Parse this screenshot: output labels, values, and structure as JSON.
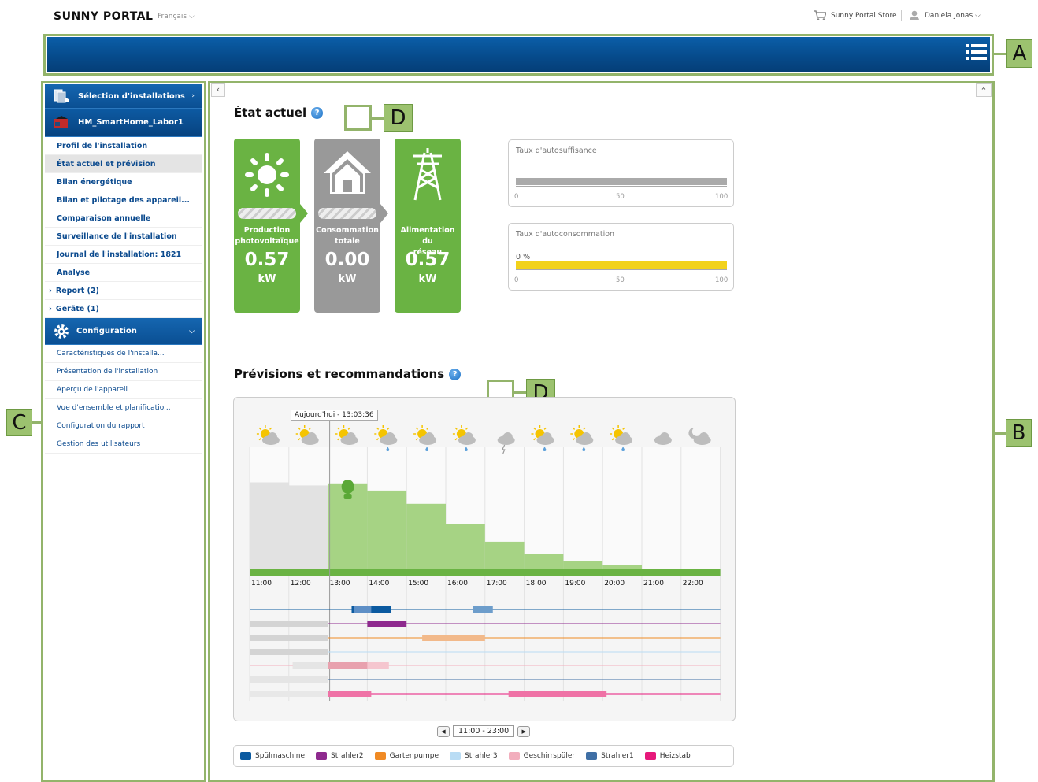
{
  "top": {
    "logo": "SUNNY PORTAL",
    "language": "Français ⌵",
    "store": "Sunny Portal Store",
    "user": "Daniela Jonas ⌵"
  },
  "callouts": {
    "a": "A",
    "b": "B",
    "c": "C",
    "d": "D"
  },
  "sidebar": {
    "plant_select": "Sélection d'installations",
    "plant_name": "HM_SmartHome_Labor1",
    "items": [
      "Profil de l'installation",
      "État actuel et prévision",
      "Bilan énergétique",
      "Bilan et pilotage des appareil...",
      "Comparaison annuelle",
      "Surveillance de l'installation",
      "Journal de l'installation: 1821",
      "Analyse"
    ],
    "expandables": [
      "Report (2)",
      "Geräte (1)"
    ],
    "config_title": "Configuration",
    "config_items": [
      "Caractéristiques de l'installa...",
      "Présentation de l'installation",
      "Aperçu de l'appareil",
      "Vue d'ensemble et planificatio...",
      "Configuration du rapport",
      "Gestion des utilisateurs"
    ]
  },
  "current": {
    "title": "État actuel",
    "tiles": [
      {
        "label1": "Production",
        "label2": "photovoltaïque",
        "value": "0.57",
        "unit": "kW"
      },
      {
        "label1": "Consommation",
        "label2": "totale",
        "value": "0.00",
        "unit": "kW"
      },
      {
        "label1": "Alimentation du",
        "label2": "réseau",
        "value": "0.57",
        "unit": "kW"
      }
    ],
    "gauge_self_sufficiency": {
      "title": "Taux d'autosuffisance",
      "value": 100
    },
    "gauge_self_consumption": {
      "title": "Taux d'autoconsommation",
      "pct_label": "0 %",
      "value": 100
    },
    "ticks": [
      "0",
      "50",
      "100"
    ],
    "colors": {
      "green": "#6ab343",
      "grey": "#999999",
      "sufficiency": "#aaaaaa",
      "consumption": "#f2d21b"
    }
  },
  "forecast": {
    "title": "Prévisions et recommandations",
    "now_label": "Aujourd'hui - 13:03:36",
    "range": "11:00 - 23:00",
    "legend": [
      {
        "name": "Spülmaschine",
        "color": "#0b5aa0"
      },
      {
        "name": "Strahler2",
        "color": "#8e2a8e"
      },
      {
        "name": "Gartenpumpe",
        "color": "#f08a24"
      },
      {
        "name": "Strahler3",
        "color": "#b9dcf4"
      },
      {
        "name": "Geschirrspüler",
        "color": "#f2aebd"
      },
      {
        "name": "Strahler1",
        "color": "#3f6fa5"
      },
      {
        "name": "Heizstab",
        "color": "#e6187a"
      }
    ]
  },
  "chart_data": {
    "type": "bar",
    "categories": [
      "11:00",
      "12:00",
      "13:00",
      "14:00",
      "15:00",
      "16:00",
      "17:00",
      "18:00",
      "19:00",
      "20:00",
      "21:00",
      "22:00"
    ],
    "values": [
      0.85,
      0.82,
      0.84,
      0.77,
      0.64,
      0.44,
      0.27,
      0.15,
      0.08,
      0.04,
      0,
      0
    ],
    "weather": [
      "sun-cloud",
      "sun-cloud",
      "sun-cloud",
      "sun-rain",
      "sun-rain",
      "sun-rain",
      "thunder",
      "sun-rain",
      "sun-rain",
      "sun-rain",
      "cloud",
      "moon-cloud"
    ],
    "past_color": "#e2e2e2",
    "forecast_color": "#a6d384",
    "baseline_color": "#6ab343",
    "ylim": [
      0,
      1
    ]
  }
}
